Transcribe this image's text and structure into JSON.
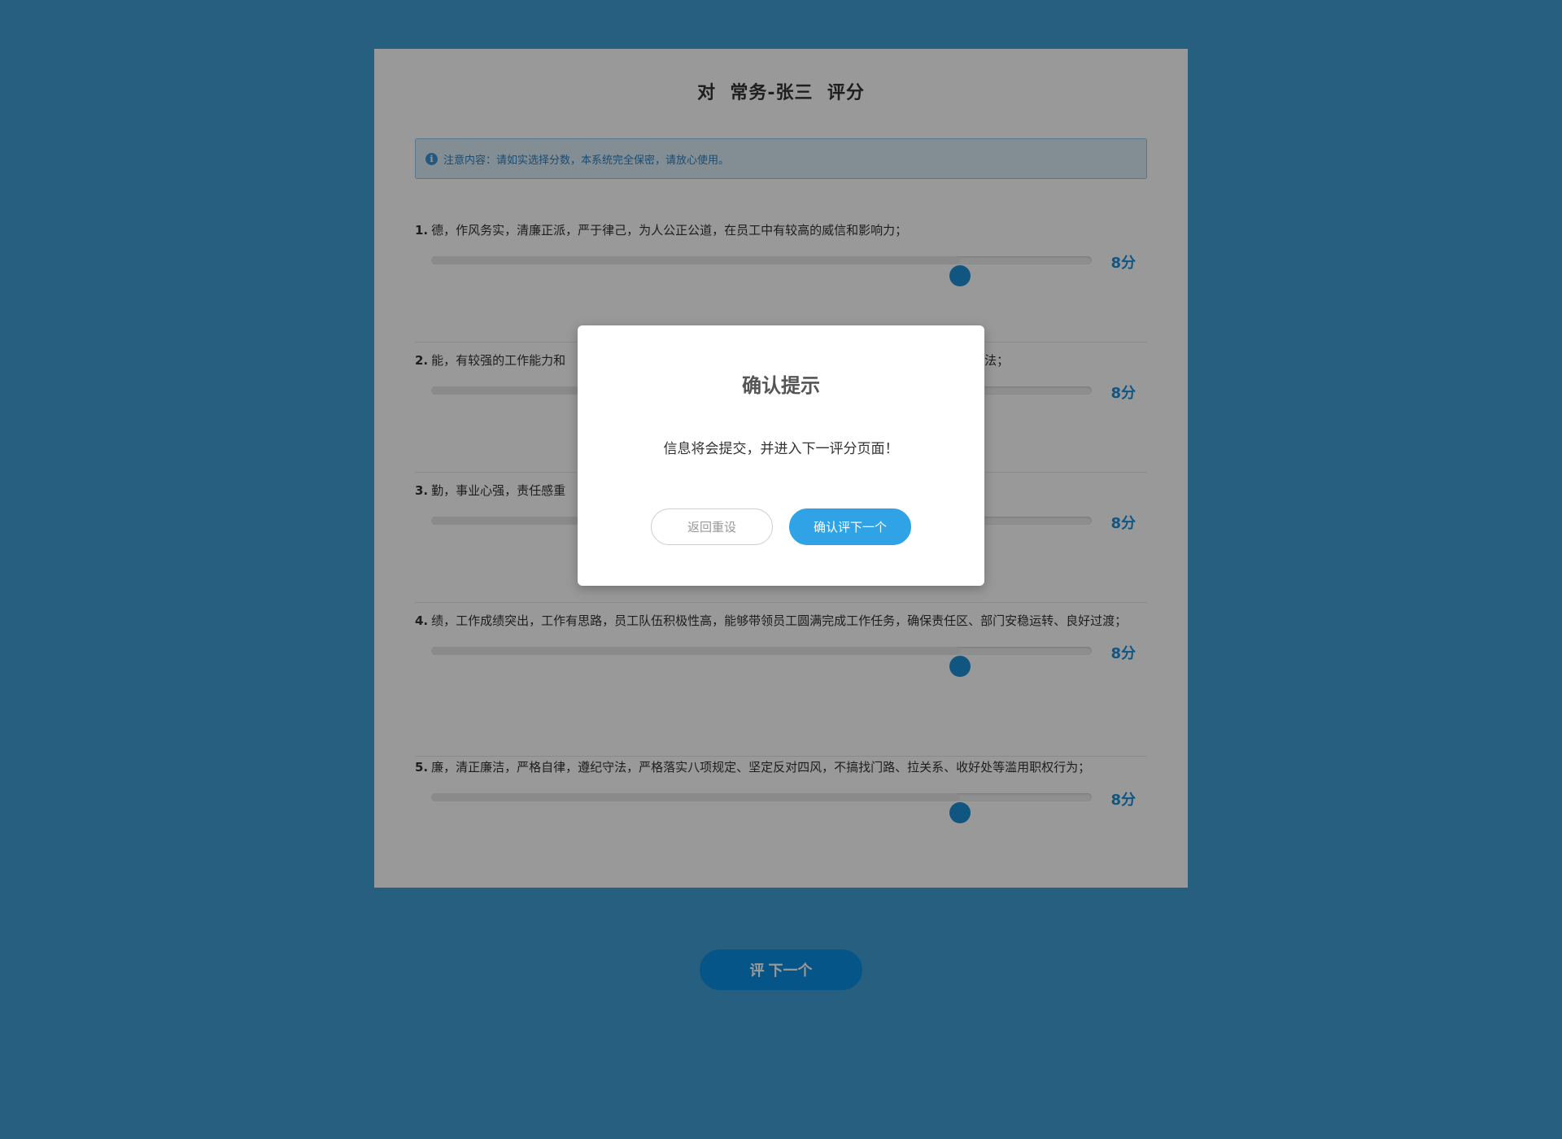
{
  "page": {
    "title": "对  常务-张三  评分",
    "notice": "注意内容：请如实选择分数，本系统完全保密，请放心使用。",
    "next_button": "评 下一个"
  },
  "colors": {
    "background": "#419fd6",
    "accent": "#1a8fdc",
    "overlay": "rgba(0,0,0,0.40)"
  },
  "slider": {
    "min": 0,
    "max": 10
  },
  "questions": [
    {
      "number": "1.",
      "text": "德，作风务实，清廉正派，严于律己，为人公正公道，在员工中有较高的威信和影响力；",
      "value": 8,
      "score_label": "8分"
    },
    {
      "number": "2.",
      "text": "能，有较强的工作能力和",
      "text_tail": "方法；",
      "value": 8,
      "score_label": "8分"
    },
    {
      "number": "3.",
      "text": "勤，事业心强，责任感重",
      "value": 8,
      "score_label": "8分"
    },
    {
      "number": "4.",
      "text": "绩，工作成绩突出，工作有思路，员工队伍积极性高，能够带领员工圆满完成工作任务，确保责任区、部门安稳运转、良好过渡；",
      "value": 8,
      "score_label": "8分"
    },
    {
      "number": "5.",
      "text": "廉，清正廉洁，严格自律，遵纪守法，严格落实八项规定、坚定反对四风，不搞找门路、拉关系、收好处等滥用职权行为；",
      "value": 8,
      "score_label": "8分"
    }
  ],
  "dialog": {
    "title": "确认提示",
    "message": "信息将会提交，并进入下一评分页面！",
    "cancel_label": "返回重设",
    "confirm_label": "确认评下一个"
  },
  "icons": {
    "notice": "info-icon"
  }
}
